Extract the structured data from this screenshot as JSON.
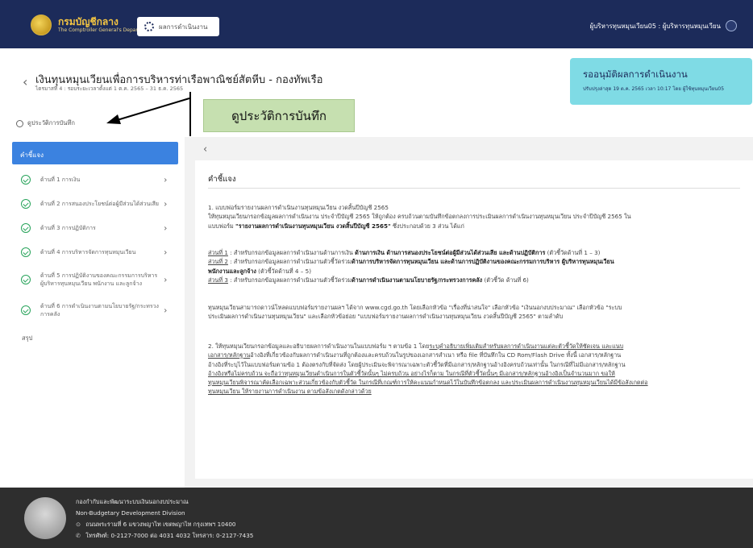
{
  "header": {
    "brand_name": "กรมบัญชีกลาง",
    "brand_sub": "The Comptroller General's Department",
    "nav_button_label": "ผลการดำเนินงาน",
    "user_text": "ผู้บริหารทุนหมุนเวียน05 : ผู้บริหารทุนหมุนเวียน"
  },
  "page": {
    "title": "เงินทุนหมุนเวียนเพื่อการบริหารท่าเรือพาณิชย์สัตหีบ - กองทัพเรือ",
    "subtitle": "ไตรมาสที่ 4 : รอบระยะเวลาตั้งแต่ 1 ต.ค. 2565 – 31 ธ.ค. 2565",
    "history_link": "ดูประวัติการบันทึก"
  },
  "status": {
    "title": "รออนุมัติผลการดำเนินงาน",
    "detail": "ปรับปรุงล่าสุด 19 ต.ค. 2565 เวลา 10:17 โดย ผู้ใช้ทุนหมุนเวียน05"
  },
  "annotation": {
    "label": "ดูประวัติการบันทึก"
  },
  "sidebar": {
    "active": "คำชี้แจง",
    "items": [
      {
        "label": "ด้านที่ 1 การเงิน"
      },
      {
        "label": "ด้านที่ 2 การสนองประโยชน์ต่อผู้มีส่วนได้ส่วนเสีย"
      },
      {
        "label": "ด้านที่ 3 การปฏิบัติการ"
      },
      {
        "label": "ด้านที่ 4 การบริหารจัดการทุนหมุนเวียน"
      },
      {
        "label": "ด้านที่ 5 การปฏิบัติงานของคณะกรรมการบริหาร ผู้บริหารทุนหมุนเวียน พนักงาน และลูกจ้าง"
      },
      {
        "label": "ด้านที่ 6 การดำเนินงานตามนโยบายรัฐ/กระทรวงการคลัง"
      }
    ],
    "summary": "สรุป"
  },
  "content": {
    "back_symbol": "‹",
    "title": "คำชี้แจง",
    "p1_line1": "1. แบบฟอร์มรายงานผลการดำเนินงานทุนหมุนเวียน งวดสิ้นปีบัญชี 2565",
    "p1_line2": "ให้ทุนหมุนเวียนกรอกข้อมูลผลการดำเนินงาน ประจำปีบัญชี 2565 ให้ถูกต้อง ครบถ้วนตามบันทึกข้อตกลงการประเมินผลการดำเนินงานทุนหมุนเวียน ประจำปีบัญชี 2565 ใน",
    "p1_line3_a": "แบบฟอร์ม ",
    "p1_line3_b": "\"รายงานผลการดำเนินงานทุนหมุนเวียน งวดสิ้นปีบัญชี 2565\"",
    "p1_line3_c": " ซึ่งประกอบด้วย 3 ส่วน ได้แก่",
    "s1_label": "ส่วนที่ 1",
    "s1_text_a": " : สำหรับกรอกข้อมูลผลการดำเนินงานด้านการเงิน ",
    "s1_text_b": "ด้านการเงิน ด้านการสนองประโยชน์ต่อผู้มีส่วนได้ส่วนเสีย และด้านปฏิบัติการ",
    "s1_text_c": " (ตัวชี้วัดด้านที่ 1 – 3)",
    "s2_label": "ส่วนที่ 2",
    "s2_text_a": " : สำหรับกรอกข้อมูลผลการดำเนินงานตัวชี้วัดร่วม",
    "s2_text_b": "ด้านการบริหารจัดการทุนหมุนเวียน และด้านการปฏิบัติงานของคณะกรรมการบริหาร ผู้บริหารทุนหมุนเวียน",
    "s2_text_c": "พนักงานและลูกจ้าง",
    "s2_text_d": " (ตัวชี้วัดด้านที่ 4 – 5)",
    "s3_label": "ส่วนที่ 3",
    "s3_text_a": " : สำหรับกรอกข้อมูลผลการดำเนินงานตัวชี้วัดร่วม",
    "s3_text_b": "ด้านการดำเนินงานตามนโยบายรัฐ/กระทรวงการคลัง",
    "s3_text_c": " (ตัวชี้วัด ด้านที่ 6)",
    "p2_line1": "ทุนหมุนเวียนสามารถดาวน์โหลดแบบฟอร์มรายงานผลฯ ได้จาก www.cgd.go.th โดยเลือกหัวข้อ \"เรื่องที่น่าสนใจ\" เลือกหัวข้อ \"เงินนอกงบประมาณ\" เลือกหัวข้อ \"ระบบ",
    "p2_line2": "ประเมินผลการดำเนินงานทุนหมุนเวียน\" และเลือกหัวข้อย่อย \"แบบฟอร์มรายงานผลการดำเนินงานทุนหมุนเวียน งวดสิ้นปีบัญชี 2565\" ตามลำดับ",
    "p3_line1_a": "2. ให้ทุนหมุนเวียนกรอกข้อมูลและอธิบายผลการดำเนินงานในแบบฟอร์ม ฯ ตามข้อ 1 โดย",
    "p3_line1_b": "ระบุคำอธิบายเพิ่มเติมสำหรับผลการดำเนินงานแต่ละตัวชี้วัดให้ชัดเจน และแนบ",
    "p3_line2_a": "เอกสาร/หลักฐาน",
    "p3_line2_b": "อ้างอิงที่เกี่ยวข้องกับผลการดำเนินงานที่ถูกต้องและครบถ้วนในรูปของเอกสารสำเนา หรือ file ที่บันทึกใน CD Rom/Flash Drive ทั้งนี้ เอกสาร/หลักฐาน",
    "p3_line3": "อ้างอิงที่ระบุไว้ในแบบฟอร์มตามข้อ 1 ต้องตรงกับที่จัดส่ง โดยผู้ประเมินจะพิจารณาเฉพาะตัวชี้วัดที่มีเอกสาร/หลักฐานอ้างอิงครบถ้วนเท่านั้น ในกรณีที่ไม่มีเอกสาร/หลักฐาน",
    "p3_line4": "อ้างอิงหรือไม่ครบถ้วน จะถือว่าทุนหมุนเวียนดำเนินการในตัวชี้วัดนั้นๆ ไม่ครบถ้วน อย่างไรก็ตาม ในกรณีที่ตัวชี้วัดนั้นๆ มีเอกสาร/หลักฐานอ้างอิงเป็นจำนวนมาก ขอให้",
    "p3_line5": "ทุนหมุนเวียนพิจารณาคัดเลือกเฉพาะส่วนเกี่ยวข้องกับตัวชี้วัด ในกรณีที่เกณฑ์การให้คะแนนกำหนดไว้ในบันทึกข้อตกลง และประเมินผลการดำเนินงานทุนหมุนเวียนได้มีข้อสังเกตต่อ",
    "p3_line6": "ทุนหมุนเวียน ให้รายงานการดำเนินงาน ตามข้อสังเกตดังกล่าวด้วย"
  },
  "footer": {
    "org_th": "กองกำกับและพัฒนาระบบเงินนอกงบประมาณ",
    "org_en": "Non-Budgetary Development Division",
    "address": "ถนนพระรามที่ 6 แขวงพญาไท เขตพญาไท กรุงเทพฯ 10400",
    "phone": "โทรศัพท์: 0-2127-7000 ต่อ 4031 4032 โทรสาร: 0-2127-7435"
  }
}
